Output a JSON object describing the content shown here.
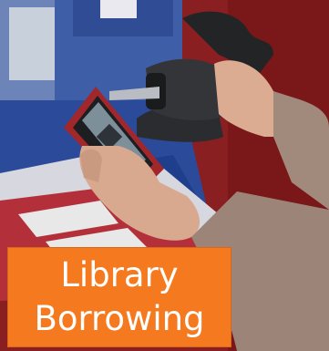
{
  "caption": {
    "line1": "Library",
    "line2": "Borrowing",
    "background": "#f57a1f",
    "text_color": "#ffffff"
  },
  "scene": {
    "subject": "hand holding a smartphone showing a QR code under a handheld barcode scanner",
    "scanner_icon": "barcode-scanner-icon",
    "phone_icon": "smartphone-icon"
  }
}
